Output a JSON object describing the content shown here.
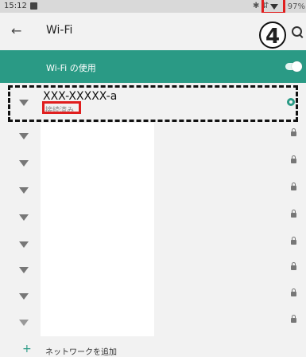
{
  "status_bar": {
    "time": "15:12",
    "battery": "97%",
    "bluetooth": "✱",
    "vibrate": "⇵"
  },
  "app_bar": {
    "back": "←",
    "title": "Wi-Fi",
    "annotation_number": "4"
  },
  "wifi_toggle": {
    "label": "Wi-Fi の使用",
    "state": "on"
  },
  "connected_network": {
    "name": "XXX-XXXXX-a",
    "status": "接続済み"
  },
  "networks_count_visible": 9,
  "add_network": {
    "plus": "+",
    "label": "ネットワークを追加"
  },
  "colors": {
    "accent": "#2a9a85",
    "annotation_red": "#e01e1e"
  }
}
